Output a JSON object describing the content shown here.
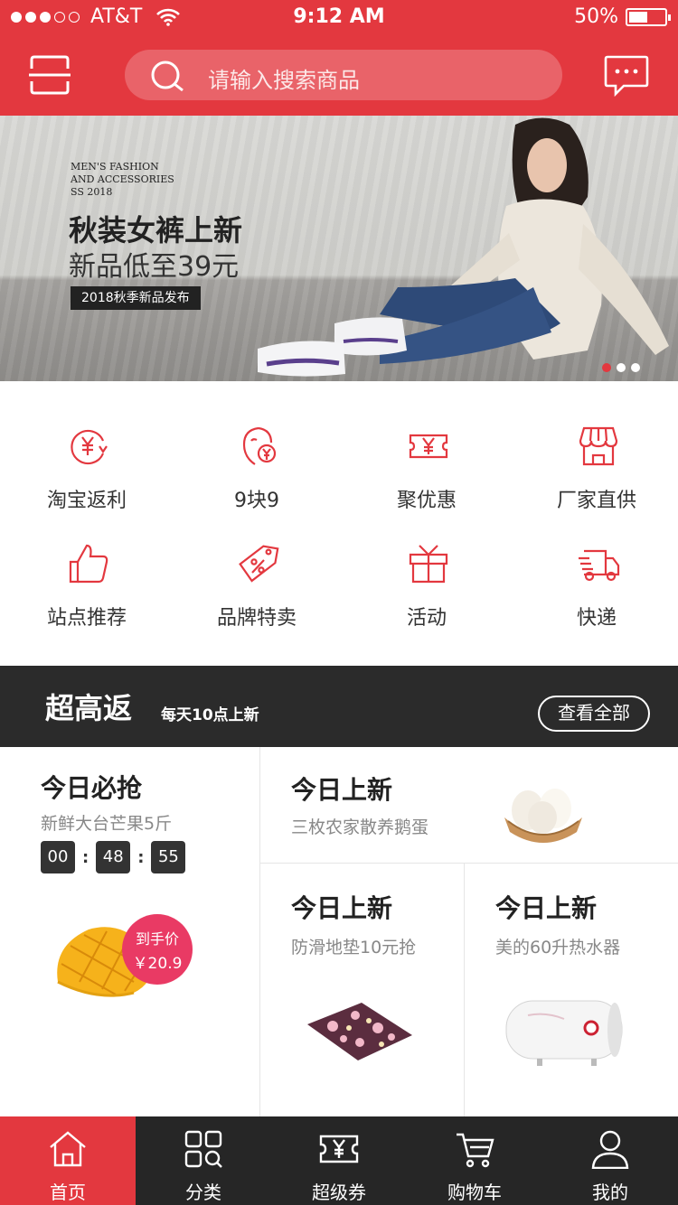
{
  "status_bar": {
    "carrier": "AT&T",
    "time": "9:12 AM",
    "battery": "50%"
  },
  "header": {
    "search_placeholder": "请输入搜索商品"
  },
  "banner": {
    "en_line1": "MEN'S FASHION",
    "en_line2": "AND ACCESSORIES",
    "en_line3": "SS 2018",
    "title": "秋装女裤上新",
    "subtitle": "新品低至39元",
    "tag": "2018秋季新品发布"
  },
  "categories": [
    {
      "label": "淘宝返利",
      "icon": "yen-cycle-icon"
    },
    {
      "label": "9块9",
      "icon": "face-yen-icon"
    },
    {
      "label": "聚优惠",
      "icon": "ticket-yen-icon"
    },
    {
      "label": "厂家直供",
      "icon": "store-icon"
    },
    {
      "label": "站点推荐",
      "icon": "thumbs-up-icon"
    },
    {
      "label": "品牌特卖",
      "icon": "discount-tag-icon"
    },
    {
      "label": "活动",
      "icon": "gift-icon"
    },
    {
      "label": "快递",
      "icon": "truck-icon"
    }
  ],
  "section": {
    "title": "超高返",
    "subtitle": "每天10点上新",
    "more": "查看全部"
  },
  "cards": {
    "flash": {
      "title": "今日必抢",
      "desc": "新鲜大台芒果5斤",
      "hh": "00",
      "mm": "48",
      "ss": "55",
      "price_label": "到手价",
      "price": "￥20.9"
    },
    "new1": {
      "title": "今日上新",
      "desc": "三枚农家散养鹅蛋"
    },
    "new2": {
      "title": "今日上新",
      "desc": "防滑地垫10元抢"
    },
    "new3": {
      "title": "今日上新",
      "desc": "美的60升热水器"
    }
  },
  "tabbar": [
    {
      "label": "首页",
      "icon": "home-icon",
      "active": true
    },
    {
      "label": "分类",
      "icon": "category-icon",
      "active": false
    },
    {
      "label": "超级券",
      "icon": "coupon-icon",
      "active": false
    },
    {
      "label": "购物车",
      "icon": "cart-icon",
      "active": false
    },
    {
      "label": "我的",
      "icon": "user-icon",
      "active": false
    }
  ],
  "colors": {
    "brand": "#e3383f",
    "dark": "#262626",
    "badge": "#e93a64"
  }
}
